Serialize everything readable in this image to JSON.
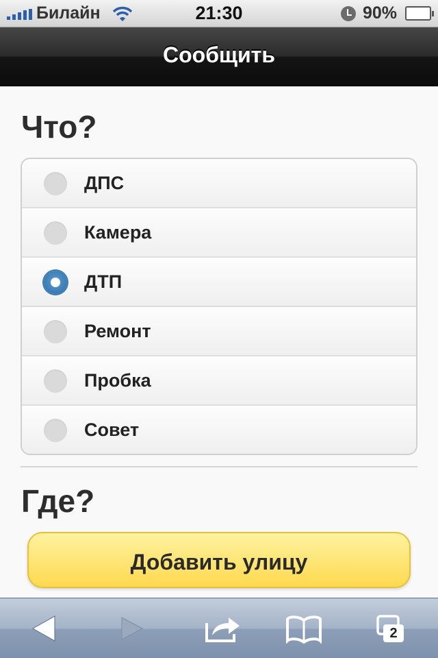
{
  "status_bar": {
    "carrier": "Билайн",
    "time": "21:30",
    "battery_percent": "90%",
    "battery_level": 0.9,
    "signal_bars": 5
  },
  "navbar": {
    "title": "Сообщить"
  },
  "form": {
    "what_heading": "Что?",
    "options": [
      {
        "label": "ДПС",
        "selected": false
      },
      {
        "label": "Камера",
        "selected": false
      },
      {
        "label": "ДТП",
        "selected": true
      },
      {
        "label": "Ремонт",
        "selected": false
      },
      {
        "label": "Пробка",
        "selected": false
      },
      {
        "label": "Совет",
        "selected": false
      }
    ],
    "where_heading": "Где?",
    "add_street_label": "Добавить улицу"
  },
  "toolbar": {
    "tabs_count": "2",
    "icons": [
      "back-arrow-icon",
      "forward-arrow-icon",
      "share-icon",
      "bookmarks-icon",
      "tabs-icon"
    ]
  },
  "colors": {
    "accent_radio": "#2b6ca6",
    "button_yellow": "#fdd94f",
    "navbar_dark": "#141414",
    "toolbar_blue": "#8d9fb8"
  }
}
